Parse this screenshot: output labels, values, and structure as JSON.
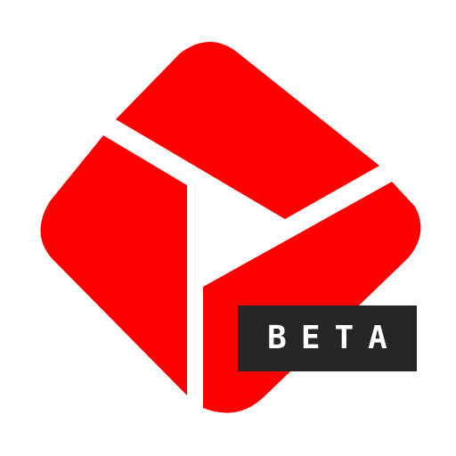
{
  "logo": {
    "icon": "play-triangle-diamond-icon",
    "color": "#ff0000",
    "gap_color": "#ffffff"
  },
  "badge": {
    "label": "BETA",
    "background": "#262626",
    "text_color": "#ffffff"
  }
}
